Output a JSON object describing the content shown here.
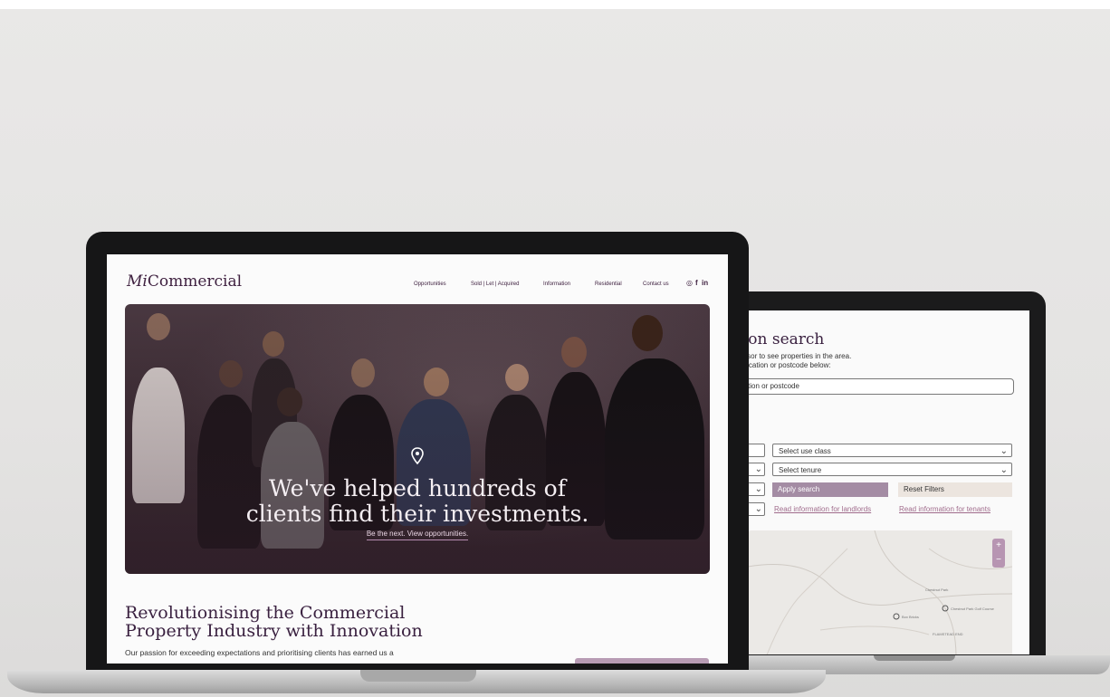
{
  "front_site": {
    "logo": {
      "prefix": "Mi",
      "suffix": "Commercial"
    },
    "nav": [
      "Opportunities",
      "Sold | Let | Acquired",
      "Information",
      "Residential",
      "Contact us"
    ],
    "social_icons": [
      "instagram-icon",
      "facebook-icon",
      "linkedin-icon"
    ],
    "hero": {
      "title_line1": "We've helped hundreds of",
      "title_line2": "clients find their investments.",
      "cta": "Be the next. View opportunities."
    },
    "section": {
      "title_line1": "Revolutionising the Commercial",
      "title_line2": "Property Industry with Innovation",
      "body_line1": "Our passion for exceeding expectations and prioritising clients has earned us a"
    }
  },
  "back_site": {
    "title": "tion search",
    "subtitle_line1": "cursor to see properties in the area.",
    "subtitle_line2": "a location or postcode below:",
    "search_placeholder": "tion or postcode",
    "filters": {
      "use_class": "Select use class",
      "tenure": "Select tenure",
      "apply": "Apply search",
      "reset": "Reset Filters",
      "landlords_link": "Read information for landlords",
      "tenants_link": "Read information for tenants"
    },
    "map": {
      "zoom_in": "+",
      "zoom_out": "−",
      "labels": [
        "Chestnut Park",
        "Chestnut Park Golf Course",
        "Box Bricks",
        "FLAMSTEAD END"
      ]
    }
  },
  "colors": {
    "brand_plum": "#3f2140",
    "accent_mauve": "#a48ca4",
    "link_pink": "#a06c8c",
    "reset_beige": "#ece5df"
  }
}
